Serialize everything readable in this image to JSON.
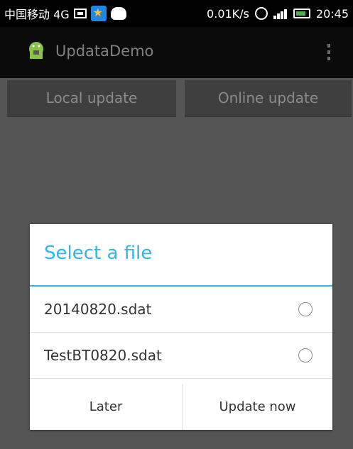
{
  "status_bar": {
    "carrier": "中国移动 4G",
    "speed": "0.01K/s",
    "time": "20:45"
  },
  "action_bar": {
    "title": "UpdataDemo"
  },
  "buttons": {
    "local": "Local update",
    "online": "Online update"
  },
  "dialog": {
    "title": "Select a file",
    "files": [
      "20140820.sdat",
      "TestBT0820.sdat"
    ],
    "later": "Later",
    "update_now": "Update now"
  },
  "icons": {
    "app": "android-icon",
    "overflow": "overflow-menu-icon"
  },
  "colors": {
    "accent": "#33b5e5"
  }
}
